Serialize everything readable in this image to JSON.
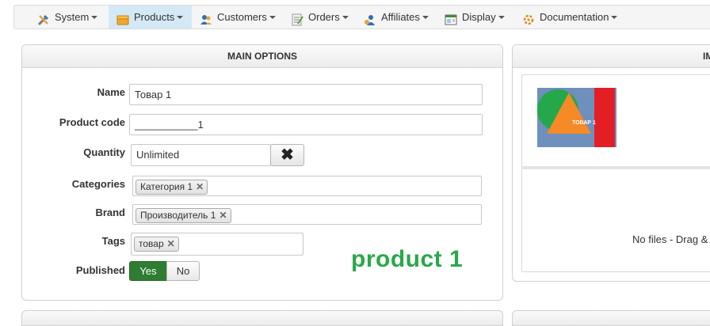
{
  "nav": {
    "items": [
      {
        "label": "System",
        "icon": "tools-icon"
      },
      {
        "label": "Products",
        "icon": "box-icon",
        "active": true
      },
      {
        "label": "Customers",
        "icon": "users-icon"
      },
      {
        "label": "Orders",
        "icon": "orders-icon"
      },
      {
        "label": "Affiliates",
        "icon": "affiliate-icon"
      },
      {
        "label": "Display",
        "icon": "display-icon"
      },
      {
        "label": "Documentation",
        "icon": "documentation-icon"
      }
    ]
  },
  "main_options": {
    "title": "MAIN OPTIONS",
    "name_label": "Name",
    "name_value": "Товар 1",
    "code_label": "Product code",
    "code_value": "___________1",
    "quantity_label": "Quantity",
    "quantity_value": "Unlimited",
    "categories_label": "Categories",
    "category_tag": "Категория 1",
    "brand_label": "Brand",
    "brand_tag": "Производитель 1",
    "tags_label": "Tags",
    "tag_value": "товар",
    "published_label": "Published",
    "yes_label": "Yes",
    "no_label": "No",
    "product_heading": "product 1"
  },
  "images_panel": {
    "title": "IM",
    "thumb_text": "ТОВАР 1",
    "drop_text": "No files - Drag &"
  },
  "colors": {
    "accent_green": "#2aa84a",
    "published_green": "#2e7d32",
    "nav_active": "#d4e9f6"
  }
}
